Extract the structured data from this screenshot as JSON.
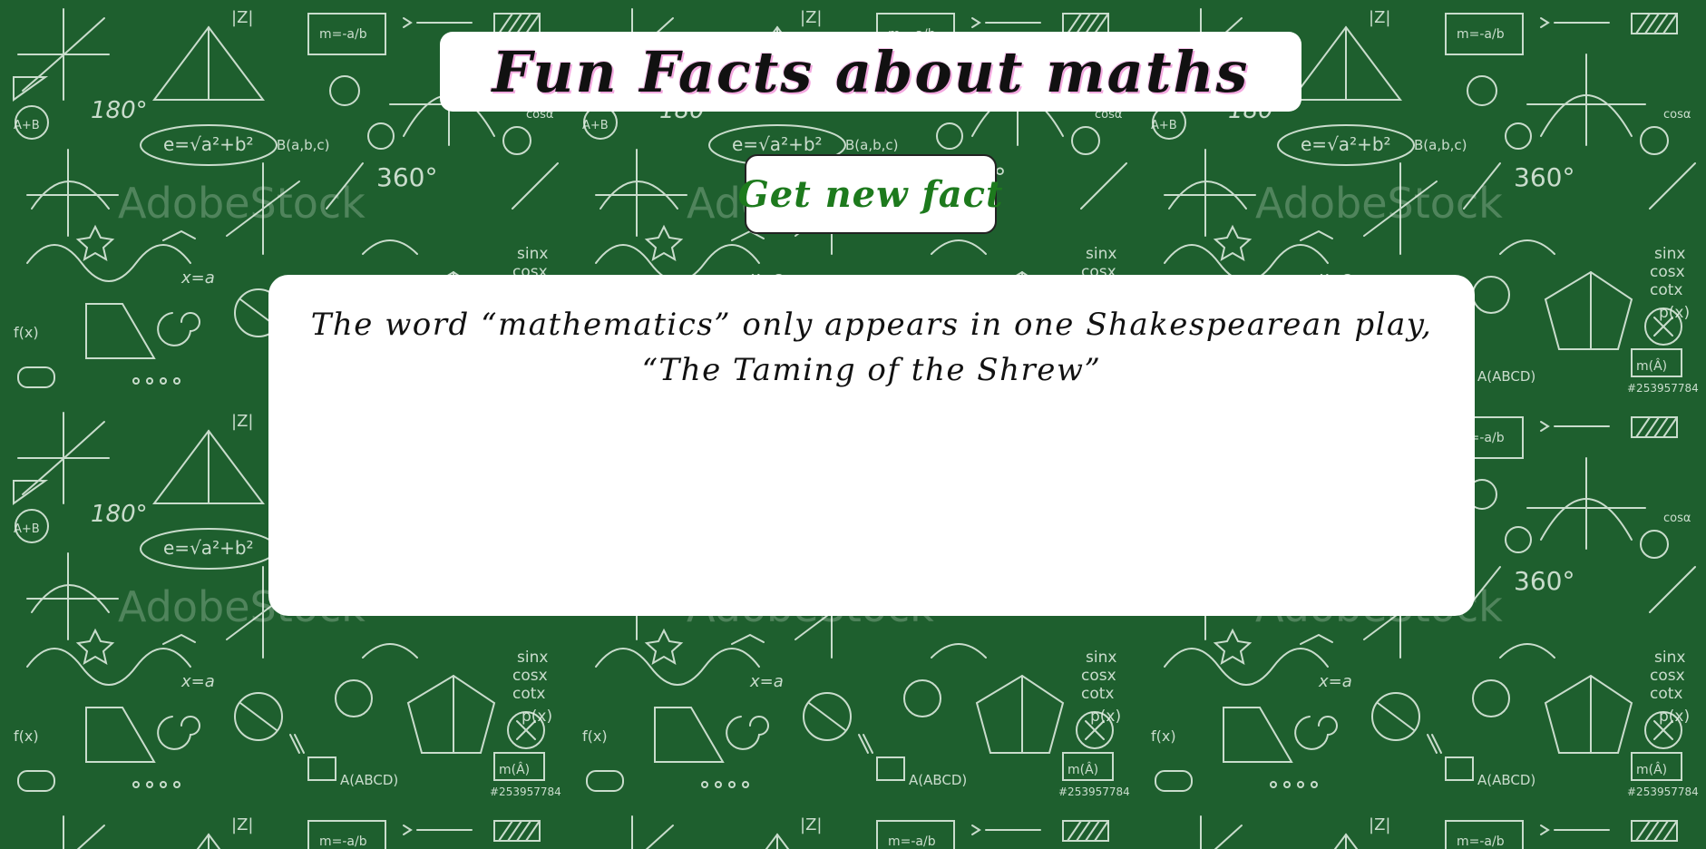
{
  "page": {
    "title": "Fun Facts about maths"
  },
  "button": {
    "label": "Get new fact"
  },
  "fact": {
    "text": "The word “mathematics” only appears in one Shakespearean play, “The Taming of the Shrew”"
  },
  "colors": {
    "background": "#1e5f2e",
    "chalk": "#e8f2e8",
    "title_shadow": "#f3a9e0",
    "button_text": "#1d7a1d"
  },
  "icons": {
    "background": "chalkboard-math-doodles"
  }
}
